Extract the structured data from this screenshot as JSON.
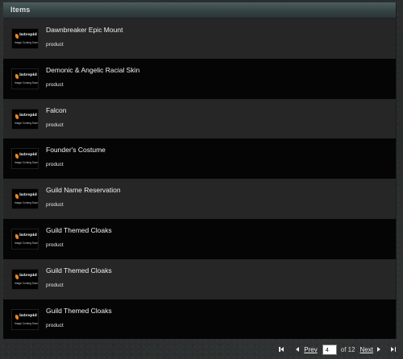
{
  "panel": {
    "title": "Items"
  },
  "placeholder_image": {
    "brand": "intrepid",
    "caption": "Image Coming Soon"
  },
  "items": [
    {
      "name": "Dawnbreaker Epic Mount",
      "type": "product"
    },
    {
      "name": "Demonic & Angelic Racial Skin",
      "type": "product"
    },
    {
      "name": "Falcon",
      "type": "product"
    },
    {
      "name": "Founder's Costume",
      "type": "product"
    },
    {
      "name": "Guild Name Reservation",
      "type": "product"
    },
    {
      "name": "Guild Themed Cloaks",
      "type": "product"
    },
    {
      "name": "Guild Themed Cloaks",
      "type": "product"
    },
    {
      "name": "Guild Themed Cloaks",
      "type": "product"
    }
  ],
  "pagination": {
    "prev_label": "Prev",
    "next_label": "Next",
    "current_page": "4",
    "of_label": "of 12"
  },
  "colors": {
    "header_accent": "#3f4e50",
    "row_odd": "#262626",
    "row_even": "#050505",
    "logo_orange": "#e8861c"
  }
}
